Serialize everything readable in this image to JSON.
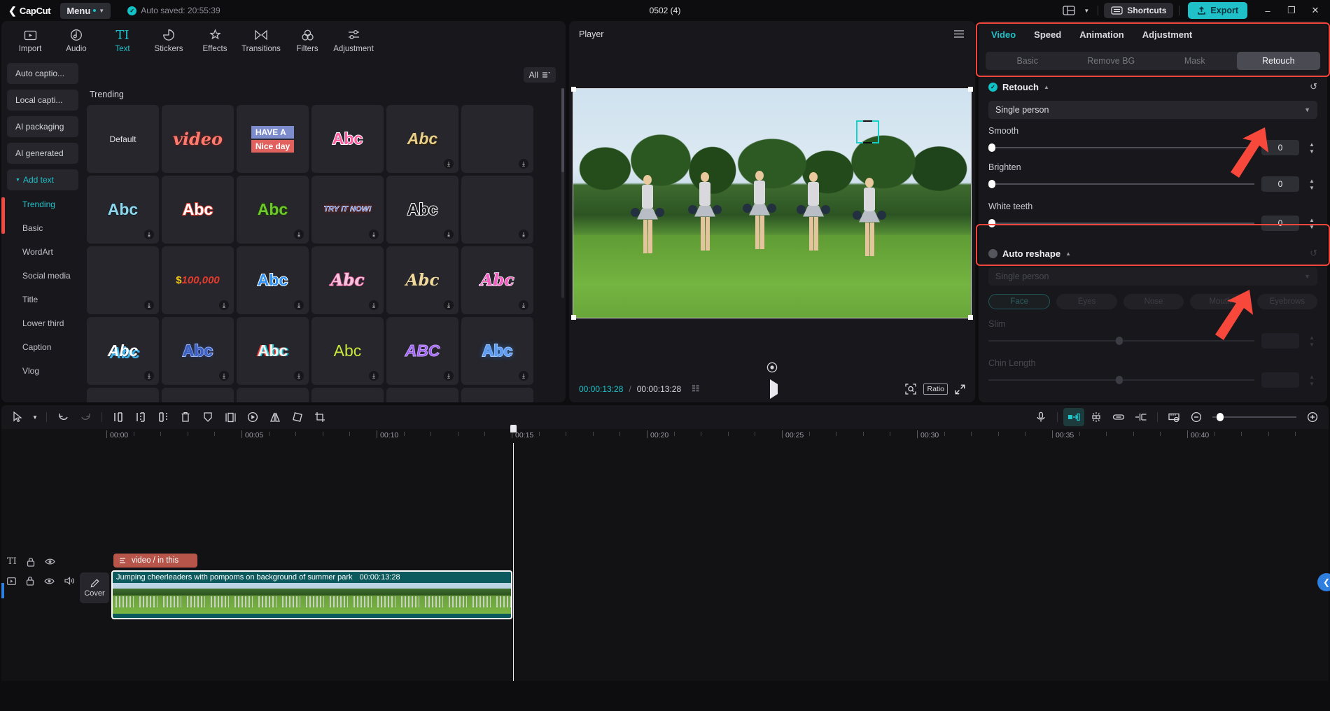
{
  "titlebar": {
    "app_name": "CapCut",
    "menu_label": "Menu",
    "autosave_text": "Auto saved: 20:55:39",
    "project_title": "0502 (4)",
    "shortcuts_label": "Shortcuts",
    "export_label": "Export",
    "layout_icon": "layout-icon",
    "minimize": "–",
    "maximize": "❐",
    "close": "✕"
  },
  "function_tabs": [
    {
      "label": "Import",
      "icon": "import-icon",
      "active": false
    },
    {
      "label": "Audio",
      "icon": "audio-icon",
      "active": false
    },
    {
      "label": "Text",
      "icon": "text-icon",
      "active": true
    },
    {
      "label": "Stickers",
      "icon": "stickers-icon",
      "active": false
    },
    {
      "label": "Effects",
      "icon": "effects-icon",
      "active": false
    },
    {
      "label": "Transitions",
      "icon": "transitions-icon",
      "active": false
    },
    {
      "label": "Filters",
      "icon": "filters-icon",
      "active": false
    },
    {
      "label": "Adjustment",
      "icon": "adjustment-icon",
      "active": false
    }
  ],
  "sidebar": {
    "buttons": [
      {
        "label": "Auto captio...",
        "accent": false
      },
      {
        "label": "Local capti...",
        "accent": false
      },
      {
        "label": "AI packaging",
        "accent": false
      },
      {
        "label": "AI generated",
        "accent": false
      },
      {
        "label": "Add text",
        "accent": true
      }
    ],
    "sub_items": [
      {
        "label": "Trending",
        "active": true
      },
      {
        "label": "Basic",
        "active": false
      },
      {
        "label": "WordArt",
        "active": false
      },
      {
        "label": "Social media",
        "active": false
      },
      {
        "label": "Title",
        "active": false
      },
      {
        "label": "Lower third",
        "active": false
      },
      {
        "label": "Caption",
        "active": false
      },
      {
        "label": "Vlog",
        "active": false
      }
    ]
  },
  "templates": {
    "filter_label": "All",
    "section_title": "Trending",
    "items": [
      {
        "text": "Default",
        "style": "lbl",
        "download": false
      },
      {
        "text": "video",
        "style": "s-video",
        "download": false
      },
      {
        "text": "HAVE A|Nice day",
        "style": "s-have",
        "download": false
      },
      {
        "text": "Abc",
        "style": "s-pink",
        "download": false
      },
      {
        "text": "Abc",
        "style": "s-gold",
        "download": true
      },
      {
        "text": "",
        "style": "empty",
        "download": true
      },
      {
        "text": "Abc",
        "style": "s-cyan",
        "download": true
      },
      {
        "text": "Abc",
        "style": "s-redout",
        "download": false
      },
      {
        "text": "Abc",
        "style": "s-green",
        "download": true
      },
      {
        "text": "TRY IT NOW!",
        "style": "s-try",
        "download": true
      },
      {
        "text": "Abc",
        "style": "s-white",
        "download": true
      },
      {
        "text": "",
        "style": "empty",
        "download": true
      },
      {
        "text": "",
        "style": "empty",
        "download": true
      },
      {
        "text": "$100,000",
        "style": "s-money",
        "download": true
      },
      {
        "text": "Abc",
        "style": "s-blue",
        "download": true
      },
      {
        "text": "Abc",
        "style": "s-script1",
        "download": true
      },
      {
        "text": "Abc",
        "style": "s-script2",
        "download": true
      },
      {
        "text": "Abc",
        "style": "s-script3",
        "download": true
      },
      {
        "text": "Abc",
        "style": "s-sky",
        "download": true
      },
      {
        "text": "Abc",
        "style": "s-navy",
        "download": true
      },
      {
        "text": "Abc",
        "style": "s-3d",
        "download": true
      },
      {
        "text": "Abc",
        "style": "s-lime",
        "download": true
      },
      {
        "text": "ABC",
        "style": "s-purple",
        "download": true
      },
      {
        "text": "Abc",
        "style": "s-neon",
        "download": true
      },
      {
        "text": "",
        "style": "empty",
        "download": false
      },
      {
        "text": "",
        "style": "empty",
        "download": false
      },
      {
        "text": "",
        "style": "empty",
        "download": false
      },
      {
        "text": "",
        "style": "empty",
        "download": false
      },
      {
        "text": "",
        "style": "empty",
        "download": false
      },
      {
        "text": "",
        "style": "empty",
        "download": false
      }
    ]
  },
  "player": {
    "title": "Player",
    "current_time": "00:00:13:28",
    "total_time": "00:00:13:28",
    "separator": "/",
    "ratio_label": "Ratio",
    "play_icon": "play-icon",
    "menu_icon": "hamburger-icon",
    "zoom_icon": "zoom-fit-icon",
    "fullscreen_icon": "fullscreen-icon",
    "grid_icon": "grid-icon",
    "record_icon": "record-icon"
  },
  "properties": {
    "tabs": [
      {
        "label": "Video",
        "active": true
      },
      {
        "label": "Speed",
        "active": false
      },
      {
        "label": "Animation",
        "active": false
      },
      {
        "label": "Adjustment",
        "active": false
      }
    ],
    "segments": [
      {
        "label": "Basic",
        "selected": false
      },
      {
        "label": "Remove BG",
        "selected": false
      },
      {
        "label": "Mask",
        "selected": false
      },
      {
        "label": "Retouch",
        "selected": true
      }
    ],
    "retouch": {
      "title": "Retouch",
      "enabled": true,
      "person_mode": "Single person",
      "sliders": [
        {
          "label": "Smooth",
          "value": "0",
          "pos": 0
        },
        {
          "label": "Brighten",
          "value": "0",
          "pos": 0
        },
        {
          "label": "White teeth",
          "value": "0",
          "pos": 0
        }
      ]
    },
    "auto_reshape": {
      "title": "Auto reshape",
      "enabled": false,
      "person_mode": "Single person",
      "pills": [
        {
          "label": "Face",
          "selected": true
        },
        {
          "label": "Eyes",
          "selected": false
        },
        {
          "label": "Nose",
          "selected": false
        },
        {
          "label": "Mouth",
          "selected": false
        },
        {
          "label": "Eyebrows",
          "selected": false
        }
      ],
      "sliders": [
        {
          "label": "Slim",
          "value": "",
          "pos": 50
        },
        {
          "label": "Chin Length",
          "value": "",
          "pos": 50
        }
      ]
    }
  },
  "timeline": {
    "tools_left": [
      {
        "icon": "cursor-select-icon",
        "name": "select-tool"
      },
      {
        "icon": "chevron-down-icon",
        "name": "select-dropdown"
      },
      {
        "icon": "undo-icon",
        "name": "undo"
      },
      {
        "icon": "redo-icon",
        "name": "redo"
      },
      {
        "icon": "split-icon",
        "name": "split"
      },
      {
        "icon": "trim-left-icon",
        "name": "trim-left"
      },
      {
        "icon": "trim-right-icon",
        "name": "trim-right"
      },
      {
        "icon": "delete-icon",
        "name": "delete"
      },
      {
        "icon": "shield-icon",
        "name": "freeze"
      },
      {
        "icon": "duplicate-icon",
        "name": "duplicate"
      },
      {
        "icon": "reverse-icon",
        "name": "reverse"
      },
      {
        "icon": "mirror-icon",
        "name": "mirror"
      },
      {
        "icon": "rotate-icon",
        "name": "rotate"
      },
      {
        "icon": "crop-icon",
        "name": "crop"
      }
    ],
    "tools_right": [
      {
        "icon": "microphone-icon",
        "name": "record-voiceover"
      },
      {
        "icon": "magnet-icon",
        "name": "snap-toggle",
        "on": true
      },
      {
        "icon": "auto-adjust-icon",
        "name": "auto-adjust"
      },
      {
        "icon": "link-icon",
        "name": "link-clips"
      },
      {
        "icon": "keyframe-icon",
        "name": "keyframe"
      },
      {
        "icon": "ruler-icon",
        "name": "preview-axis"
      },
      {
        "icon": "zoom-out-icon",
        "name": "zoom-out"
      },
      {
        "icon": "zoom-in-icon",
        "name": "zoom-in"
      }
    ],
    "ruler_labels": [
      "00:00",
      "00:05",
      "00:10",
      "00:15",
      "00:20",
      "00:25",
      "00:30",
      "00:35",
      "00:40"
    ],
    "cover_label": "Cover",
    "text_clip_label": "video / in this",
    "video_clip_label": "Jumping cheerleaders with pompoms on background of summer park",
    "video_clip_duration": "00:00:13:28",
    "text_track_icons": [
      "text-track-icon",
      "lock-icon",
      "eye-icon"
    ],
    "video_track_icons": [
      "video-track-icon",
      "lock-icon",
      "eye-icon",
      "speaker-icon"
    ],
    "fab_icon": "chevron-left-icon"
  },
  "colors": {
    "accent": "#1fc0c8",
    "highlight_red": "#f0463c",
    "clip_teal": "#0c5a5e",
    "clip_text_red": "#b8554a"
  }
}
